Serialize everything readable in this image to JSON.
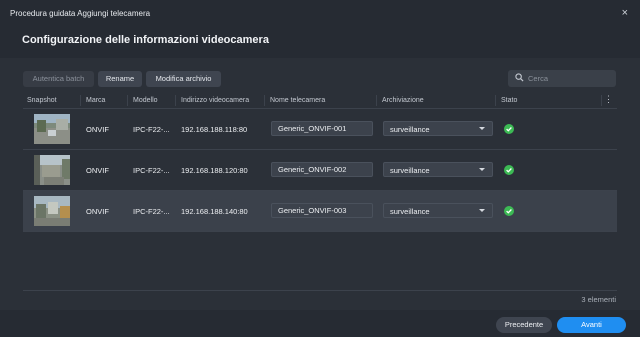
{
  "window": {
    "title": "Procedura guidata Aggiungi telecamera",
    "close_glyph": "×"
  },
  "page": {
    "title": "Configurazione delle informazioni videocamera"
  },
  "toolbar": {
    "batch_auth": "Autentica batch",
    "rename": "Rename",
    "edit_archive": "Modifica archivio"
  },
  "search": {
    "placeholder": "Cerca"
  },
  "table": {
    "columns": [
      "Snapshot",
      "Marca",
      "Modello",
      "Indirizzo videocamera",
      "Nome telecamera",
      "Archiviazione",
      "Stato"
    ],
    "menu_glyph": "⋮",
    "rows": [
      {
        "brand": "ONVIF",
        "model": "IPC-F22-...",
        "address": "192.168.188.118:80",
        "name": "Generic_ONVIF-001",
        "storage": "surveillance",
        "status": "ok"
      },
      {
        "brand": "ONVIF",
        "model": "IPC-F22-...",
        "address": "192.168.188.120:80",
        "name": "Generic_ONVIF-002",
        "storage": "surveillance",
        "status": "ok"
      },
      {
        "brand": "ONVIF",
        "model": "IPC-F22-...",
        "address": "192.168.188.140:80",
        "name": "Generic_ONVIF-003",
        "storage": "surveillance",
        "status": "ok"
      }
    ],
    "count_label": "3 elementi"
  },
  "footer": {
    "previous": "Precedente",
    "next": "Avanti"
  },
  "colors": {
    "accent": "#1f8ef1",
    "status_ok": "#3cba54",
    "background": "#2b3038"
  },
  "icons": {
    "search": "search-icon",
    "status": "check-circle-icon",
    "dropdown": "caret-down-icon",
    "close": "close-icon"
  }
}
